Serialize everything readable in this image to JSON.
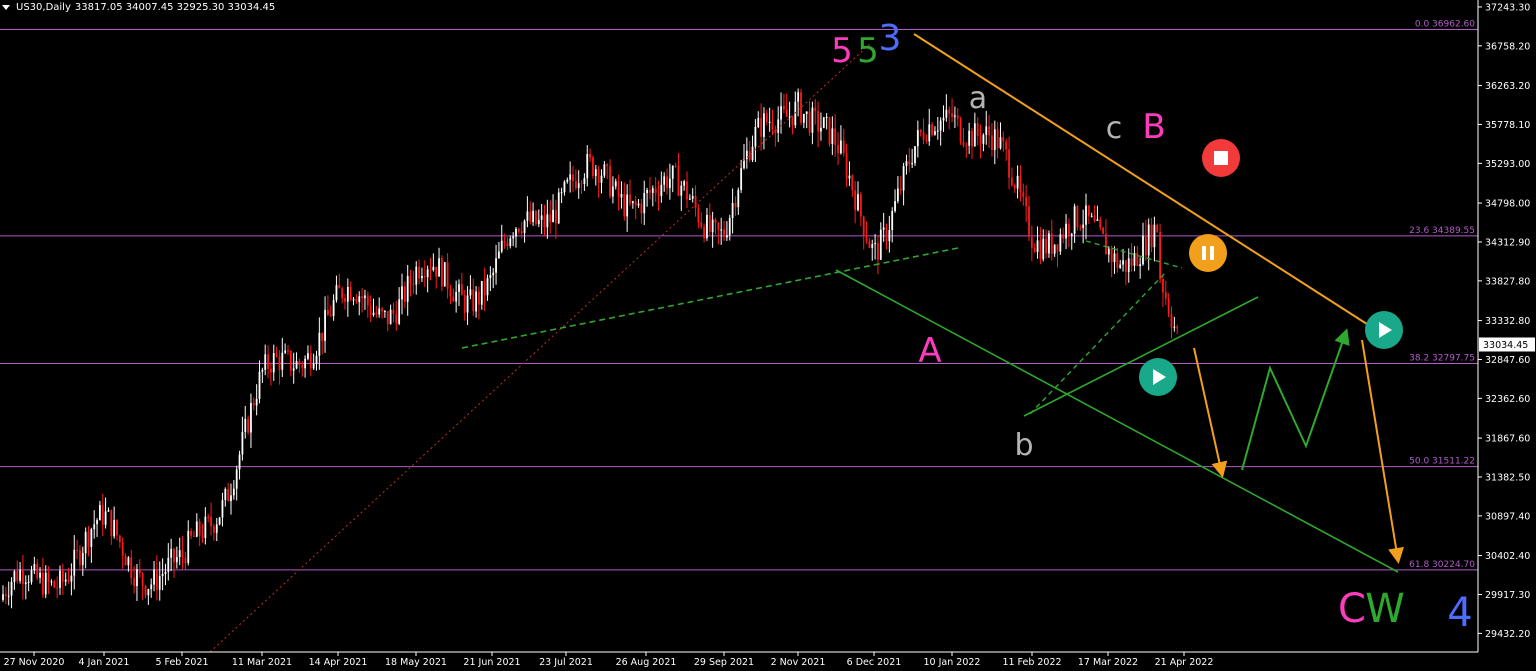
{
  "header": {
    "symbol": "US30,Daily",
    "ohlc": "33817.05 34007.45 32925.30 33034.45"
  },
  "colors": {
    "background": "#000000",
    "bull_candle": "#ffffff",
    "bear_candle": "#ff1a1a",
    "fib_line": "#b05cc8",
    "channel": "#2ea82e",
    "resistance": "#f2a01c",
    "pink": "#ff3cbe",
    "green": "#2ea82e",
    "blue": "#4e6cff",
    "gray": "#b4b4b4",
    "stop": "#f23a3a",
    "pause": "#f2a01c",
    "play": "#1aa88a"
  },
  "chart_data": {
    "type": "candlestick",
    "instrument": "US30",
    "timeframe": "Daily",
    "last_price": "33034.45",
    "ylim": [
      29200,
      37330
    ],
    "y_ticks": [
      "37243.30",
      "36758.20",
      "36263.20",
      "35778.10",
      "35293.00",
      "34798.00",
      "34312.90",
      "33827.80",
      "33332.80",
      "32847.60",
      "32362.60",
      "31867.60",
      "31382.50",
      "30897.40",
      "30402.40",
      "29917.30",
      "29432.20"
    ],
    "x_ticks": [
      "27 Nov 2020",
      "4 Jan 2021",
      "5 Feb 2021",
      "11 Mar 2021",
      "14 Apr 2021",
      "18 May 2021",
      "21 Jun 2021",
      "23 Jul 2021",
      "26 Aug 2021",
      "29 Sep 2021",
      "2 Nov 2021",
      "6 Dec 2021",
      "10 Jan 2022",
      "11 Feb 2022",
      "17 Mar 2022",
      "21 Apr 2022"
    ],
    "fib_levels": [
      {
        "label": "0.0 36962.60",
        "value": 36962.6
      },
      {
        "label": "23.6 34389.55",
        "value": 34389.55
      },
      {
        "label": "38.2 32797.75",
        "value": 32797.75
      },
      {
        "label": "50.0 31511.22",
        "value": 31511.22
      },
      {
        "label": "61.8 30224.70",
        "value": 30224.7
      }
    ],
    "close_path": [
      [
        "27 Nov 2020",
        29850
      ],
      [
        "4 Jan 2021",
        30600
      ],
      [
        "5 Feb 2021",
        30300
      ],
      [
        "11 Mar 2021",
        32300
      ],
      [
        "14 Apr 2021",
        33400
      ],
      [
        "18 May 2021",
        34000
      ],
      [
        "21 Jun 2021",
        33700
      ],
      [
        "23 Jul 2021",
        35000
      ],
      [
        "26 Aug 2021",
        35200
      ],
      [
        "29 Sep 2021",
        34500
      ],
      [
        "2 Nov 2021",
        36200
      ],
      [
        "6 Dec 2021",
        34600
      ],
      [
        "10 Jan 2022",
        36000
      ],
      [
        "11 Feb 2022",
        34500
      ],
      [
        "17 Mar 2022",
        34500
      ],
      [
        "21 Apr 2022",
        34200
      ]
    ],
    "wave_labels": [
      {
        "text": "5",
        "color": "pink",
        "x": "2 Nov 2021",
        "y": 36850
      },
      {
        "text": "5",
        "color": "green",
        "x": "2 Nov 2021",
        "y": 36850
      },
      {
        "text": "3",
        "color": "blue",
        "x": "6 Dec 2021",
        "y": 36950
      },
      {
        "text": "a",
        "color": "gray",
        "x": "10 Jan 2022",
        "y": 36260
      },
      {
        "text": "A",
        "color": "pink",
        "x": "10 Jan 2022",
        "y": 33000
      },
      {
        "text": "b",
        "color": "gray",
        "x": "11 Feb 2022",
        "y": 31850
      },
      {
        "text": "c",
        "color": "gray",
        "x": "17 Mar 2022",
        "y": 35720
      },
      {
        "text": "B",
        "color": "pink",
        "x": "21 Apr 2022",
        "y": 35720
      },
      {
        "text": "C",
        "color": "pink",
        "x": "21 Apr 2022",
        "y": 29800
      },
      {
        "text": "W",
        "color": "green",
        "x": "21 Apr 2022",
        "y": 29800
      },
      {
        "text": "4",
        "color": "blue",
        "x": "21 Apr 2022",
        "y": 29600
      }
    ]
  }
}
